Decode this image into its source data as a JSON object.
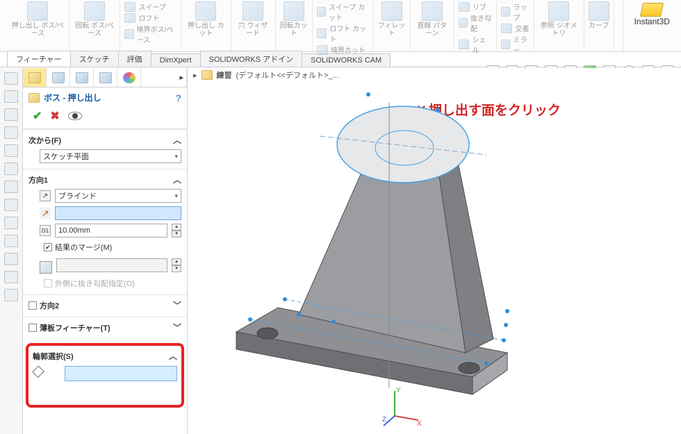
{
  "ribbon": {
    "extrude_boss": "押し出し\nボス/ベース",
    "revolve_boss": "回転\nボス/ベース",
    "sweep": "スイープ",
    "loft": "ロフト",
    "boundary_boss": "境界ボス/ベース",
    "extrude_cut": "押し出し\nカット",
    "hole_wizard": "穴\nウィザード",
    "revolve_cut": "回転カット",
    "sweep_cut": "スイープ カット",
    "loft_cut": "ロフト カット",
    "boundary_cut": "境界カット",
    "fillet": "フィレット",
    "linear_pattern": "直線\nパターン",
    "rib": "リブ",
    "draft": "抜き勾配",
    "shell": "シェル",
    "wrap": "ラップ",
    "intersect": "交差",
    "mirror": "ミラー",
    "ref_geom": "参照\nジオメトリ",
    "curves": "カーブ",
    "instant3d": "Instant3D"
  },
  "tabs": {
    "features": "フィーチャー",
    "sketch": "スケッチ",
    "evaluate": "評価",
    "dimxpert": "DimXpert",
    "swaddins": "SOLIDWORKS アドイン",
    "swcam": "SOLIDWORKS CAM"
  },
  "breadcrumb": {
    "part": "練習",
    "config": "(デフォルト<<デフォルト>_..."
  },
  "feature": {
    "title": "ボス - 押し出し",
    "from_label": "次から(F)",
    "from_value": "スケッチ平面",
    "dir1_label": "方向1",
    "dir1_type": "ブラインド",
    "depth": "10.00mm",
    "merge": "結果のマージ(M)",
    "draft_outward": "外側に抜き勾配指定(O)",
    "dir2_label": "方向2",
    "thin_label": "薄板フィーチャー(T)",
    "contour_label": "輪郭選択(S)"
  },
  "callout": {
    "text": "押し出す面をクリック",
    "mark": "×"
  },
  "triad": {
    "x": "X",
    "y": "Y",
    "z": "Z"
  }
}
